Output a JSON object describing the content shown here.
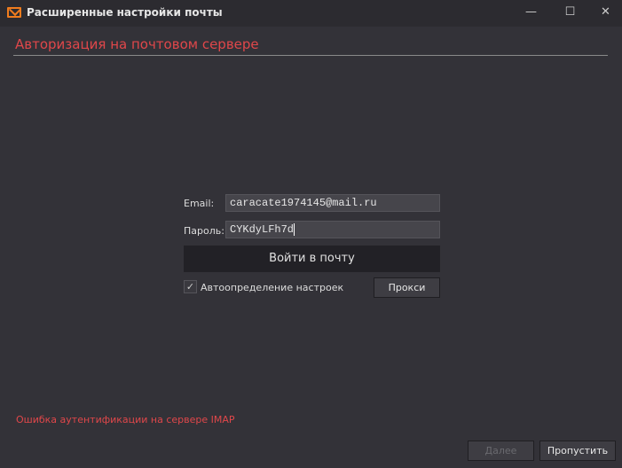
{
  "window": {
    "title": "Расширенные настройки почты",
    "minimize": "—",
    "maximize": "☐",
    "close": "✕"
  },
  "header": {
    "title": "Авторизация на почтовом сервере"
  },
  "form": {
    "email_label": "Email:",
    "email_value": "caracate1974145@mail.ru",
    "password_label": "Пароль:",
    "password_value": "CYKdyLFh7d",
    "login_button": "Войти в почту",
    "auto_checkbox_label": "Автоопределение настроек",
    "auto_checked": true,
    "proxy_button": "Прокси"
  },
  "status": {
    "error": "Ошибка аутентификации на сервере IMAP"
  },
  "footer": {
    "next": "Далее",
    "skip": "Пропустить"
  },
  "colors": {
    "accent": "#e0474a",
    "icon": "#f07c1e"
  }
}
